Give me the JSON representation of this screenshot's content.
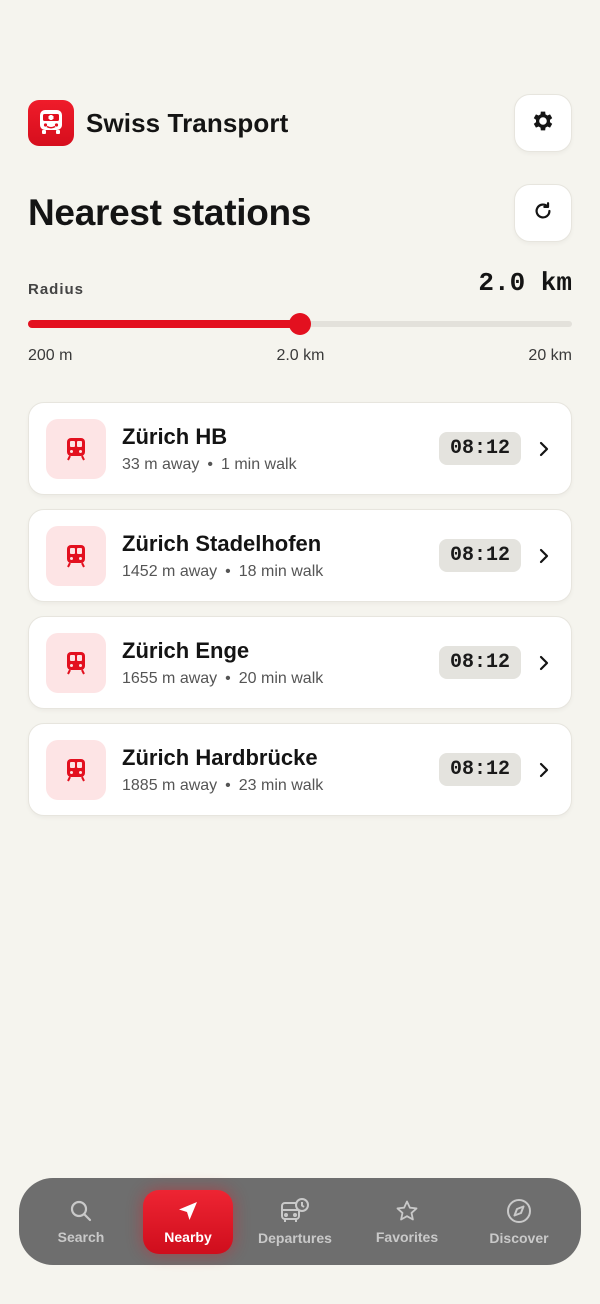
{
  "header": {
    "app_title": "Swiss Transport",
    "logo_icon": "bus-icon",
    "settings_icon": "gear-icon"
  },
  "section": {
    "title": "Nearest stations",
    "refresh_icon": "refresh-icon"
  },
  "radius": {
    "label": "Radius",
    "value": "2.0 km",
    "fraction": 0.5,
    "min_label": "200 m",
    "mid_label": "2.0 km",
    "max_label": "20 km"
  },
  "stations": [
    {
      "name": "Zürich HB",
      "distance": "33 m away",
      "walk": "1 min walk",
      "time": "08:12"
    },
    {
      "name": "Zürich Stadelhofen",
      "distance": "1452 m away",
      "walk": "18 min walk",
      "time": "08:12"
    },
    {
      "name": "Zürich Enge",
      "distance": "1655 m away",
      "walk": "20 min walk",
      "time": "08:12"
    },
    {
      "name": "Zürich Hardbrücke",
      "distance": "1885 m away",
      "walk": "23 min walk",
      "time": "08:12"
    }
  ],
  "tabs": [
    {
      "label": "Search",
      "icon": "search-icon",
      "active": false
    },
    {
      "label": "Nearby",
      "icon": "navigation-arrow-icon",
      "active": true
    },
    {
      "label": "Departures",
      "icon": "bus-clock-icon",
      "active": false
    },
    {
      "label": "Favorites",
      "icon": "star-icon",
      "active": false
    },
    {
      "label": "Discover",
      "icon": "compass-icon",
      "active": false
    }
  ],
  "colors": {
    "accent": "#e3101f",
    "background": "#f5f4ee",
    "station_icon_bg": "#fde4e5",
    "tab_bar": "#6e6e6e"
  }
}
